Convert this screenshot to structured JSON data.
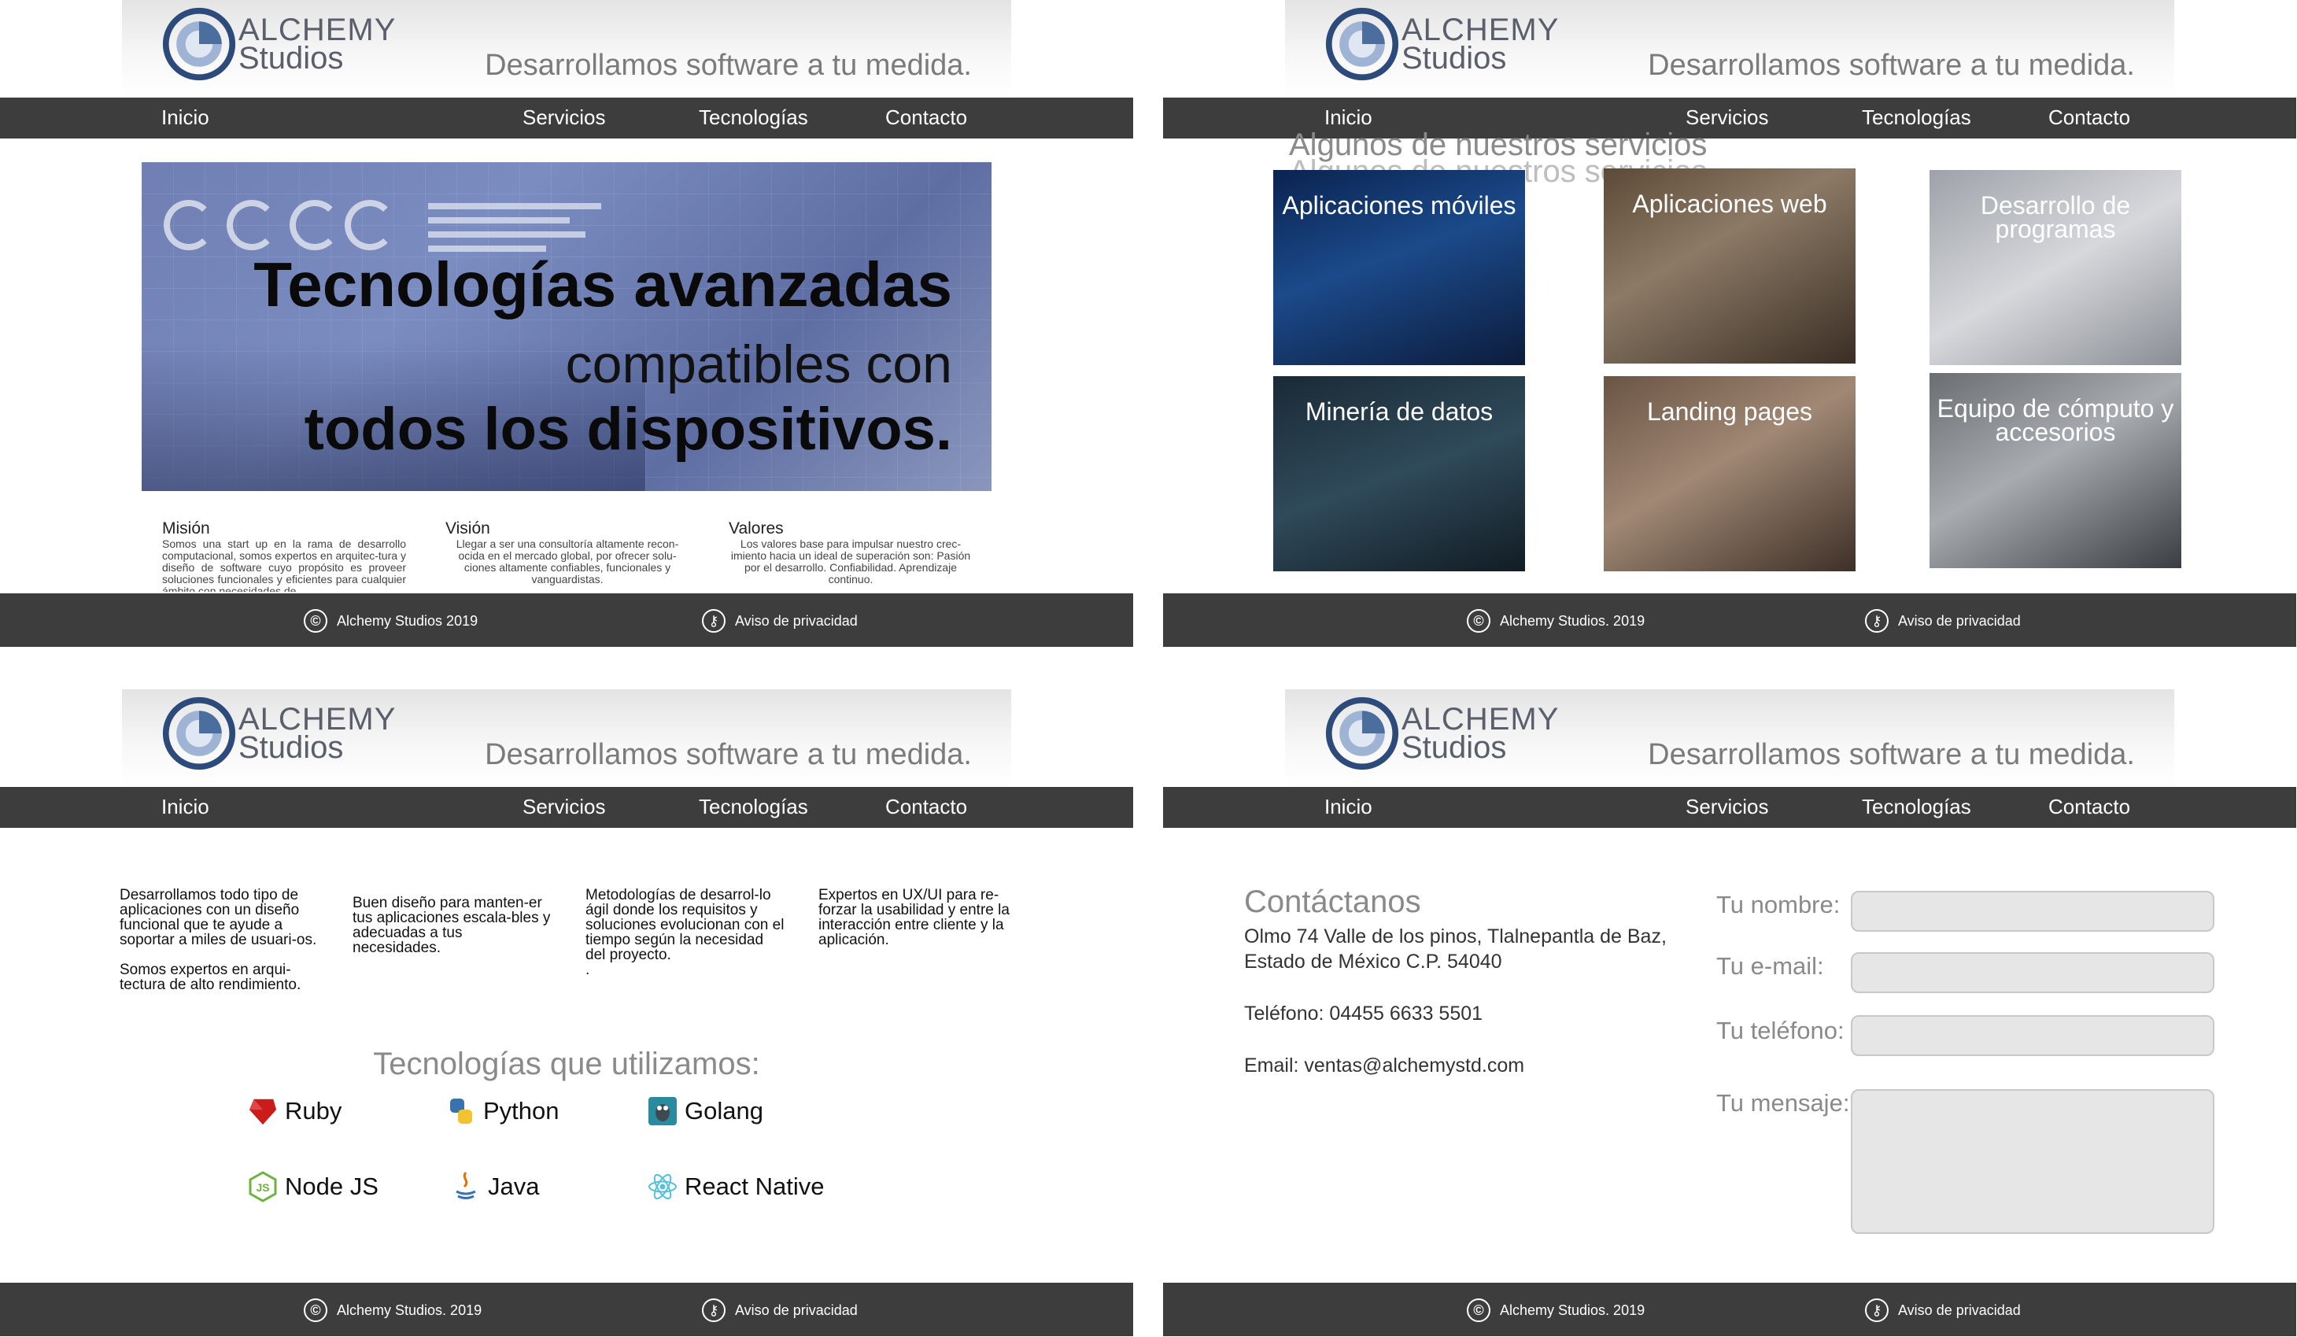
{
  "brand": {
    "line1": "ALCHEMY",
    "line2": "Studios",
    "tagline": "Desarrollamos software a tu medida."
  },
  "nav": {
    "inicio": "Inicio",
    "servicios": "Servicios",
    "tecnologias": "Tecnologías",
    "contacto": "Contacto"
  },
  "footer": {
    "copyright_p1": "Alchemy Studios  2019",
    "copyright": "Alchemy Studios. 2019",
    "privacy": "Aviso de privacidad"
  },
  "home": {
    "hero": {
      "line1": "Tecnologías avanzadas",
      "line2": "compatibles con",
      "line3": "todos los dispositivos."
    },
    "mission": {
      "title": "Misión",
      "text": "Somos una start up en la rama de desarrollo computacional, somos expertos en arquitec-tura y diseño de software cuyo propósito es proveer soluciones funcionales y eficientes para cualquier ámbito con necesidades de"
    },
    "vision": {
      "title": "Visión",
      "text": "Llegar a ser una consultoría altamente recon-ocida en el mercado global, por ofrecer solu-ciones altamente confiables, funcionales y vanguardistas."
    },
    "values": {
      "title": "Valores",
      "text": "Los valores base para impulsar nuestro crec-imiento hacia un ideal de superación son: Pasión por el desarrollo. Confiabilidad. Aprendizaje continuo."
    }
  },
  "services": {
    "title": "Algunos de nuestros servicios",
    "items": [
      {
        "label": "Aplicaciones móviles"
      },
      {
        "label": "Aplicaciones web"
      },
      {
        "label": "Desarrollo de programas"
      },
      {
        "label": "Minería de datos"
      },
      {
        "label": "Landing pages"
      },
      {
        "label": "Equipo de cómputo y accesorios"
      }
    ]
  },
  "technologies": {
    "columns": [
      "Desarrollamos todo tipo de aplicaciones con un diseño funcional que te ayude a soportar a miles de usuari-os.\n\nSomos expertos en arqui-tectura de alto rendimiento.",
      "Buen diseño para manten-er tus aplicaciones escala-bles y adecuadas a tus necesidades.",
      "Metodologías de desarrol-lo ágil donde los requisitos y soluciones evolucionan con el tiempo según la necesidad del proyecto.\n.",
      "Expertos en UX/UI para re-forzar la usabilidad y entre la interacción entre cliente y la aplicación."
    ],
    "title": "Tecnologías que utilizamos:",
    "items": [
      {
        "name": "Ruby",
        "icon": "ruby-icon",
        "color": "#cc1b1b"
      },
      {
        "name": "Python",
        "icon": "python-icon",
        "color": "#3a72b0"
      },
      {
        "name": "Golang",
        "icon": "golang-icon",
        "color": "#2a8aa0"
      },
      {
        "name": "Node JS",
        "icon": "nodejs-icon",
        "color": "#6cb33f"
      },
      {
        "name": "Java",
        "icon": "java-icon",
        "color": "#e76f00"
      },
      {
        "name": "React Native",
        "icon": "react-icon",
        "color": "#53c1de"
      }
    ]
  },
  "contact": {
    "title": "Contáctanos",
    "address1": "Olmo 74 Valle de los pinos, Tlalnepantla de Baz,",
    "address2": "Estado de México C.P. 54040",
    "phone": "Teléfono: 04455 6633 5501",
    "email": "Email: ventas@alchemystd.com",
    "form": {
      "name_label": "Tu nombre:",
      "email_label": "Tu e-mail:",
      "phone_label": "Tu teléfono:",
      "message_label": "Tu mensaje:"
    }
  }
}
